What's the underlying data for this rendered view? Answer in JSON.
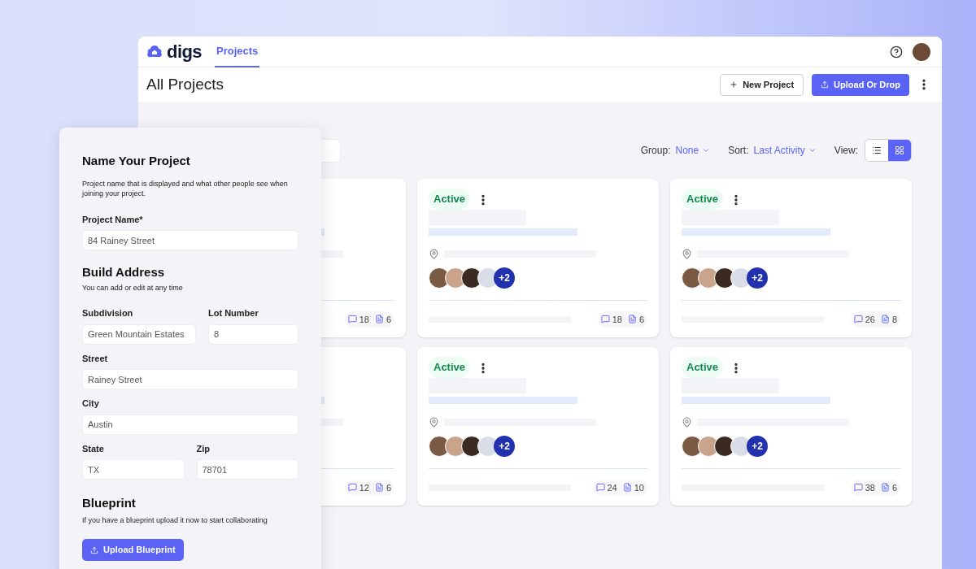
{
  "app": {
    "logo": "digs",
    "tabs": [
      {
        "label": "Projects",
        "selected": true
      }
    ]
  },
  "page": {
    "title": "All Projects",
    "actions": [
      {
        "label": "New Project",
        "kind": "outline"
      },
      {
        "label": "Upload Or Drop",
        "kind": "primary"
      }
    ]
  },
  "toolbar": {
    "group_label": "Group:",
    "group_value": "None",
    "sort_label": "Sort:",
    "sort_value": "Last Activity",
    "view_label": "View:",
    "views": [
      {
        "kind": "list",
        "selected": false
      },
      {
        "kind": "grid",
        "selected": true
      }
    ]
  },
  "cards": [
    {
      "comments": "18",
      "files": "6"
    },
    {
      "status": "Active",
      "extra_members": "+2",
      "comments": "18",
      "files": "6"
    },
    {
      "status": "Active",
      "extra_members": "+2",
      "comments": "26",
      "files": "8"
    },
    {
      "comments": "12",
      "files": "6"
    },
    {
      "status": "Active",
      "extra_members": "+2",
      "comments": "24",
      "files": "10"
    },
    {
      "status": "Active",
      "extra_members": "+2",
      "comments": "38",
      "files": "6"
    }
  ],
  "form": {
    "title": "Name Your Project",
    "description": "Project name that is displayed and what other people see when joining your project.",
    "project_name": {
      "label": "Project Name*",
      "value": "84 Rainey Street"
    },
    "address_title": "Build Address",
    "address_hint": "You can add or edit at any time",
    "rows": [
      [
        {
          "label": "Subdivision",
          "value": "Green Mountain Estates"
        },
        {
          "label": "Lot Number",
          "value": "8"
        }
      ],
      [
        {
          "label": "Street",
          "value": "Rainey Street"
        }
      ],
      [
        {
          "label": "City",
          "value": "Austin"
        }
      ],
      [
        {
          "label": "State",
          "value": "TX"
        },
        {
          "label": "Zip",
          "value": "78701"
        }
      ]
    ],
    "blueprint_title": "Blueprint",
    "blueprint_hint": "If you have a blueprint upload it now to start collaborating",
    "upload_button": "Upload Blueprint"
  }
}
